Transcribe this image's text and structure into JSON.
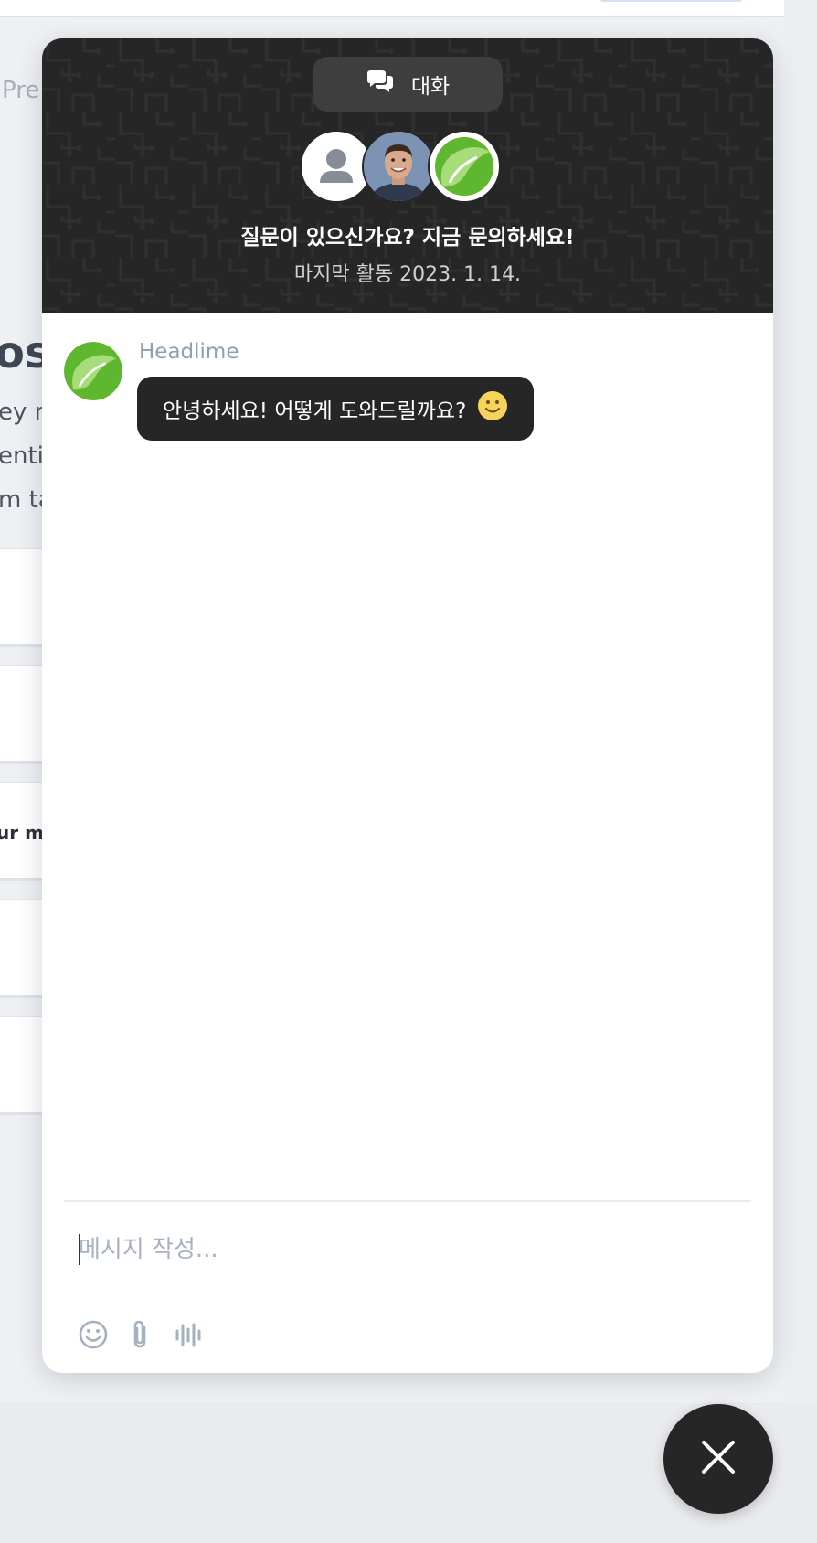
{
  "background": {
    "partial_pre": "Pre",
    "partial_heading": "osi",
    "partial_lines": [
      "ey n",
      "entic",
      "m ta"
    ],
    "partial_card_text": "ur ma"
  },
  "chat": {
    "tab_label": "대화",
    "headline": "질문이 있으신가요? 지금 문의하세요!",
    "last_active": "마지막 활동 2023. 1. 14.",
    "messages": [
      {
        "sender": "Headlime",
        "text": "안녕하세요! 어떻게 도와드릴까요?",
        "emoji": "🙂"
      }
    ],
    "composer": {
      "placeholder": "메시지 작성..."
    },
    "colors": {
      "header_bg": "#262626",
      "bubble_bg": "#262626",
      "accent_green": "#5fb62f"
    },
    "icons": [
      "chat-bubbles-icon",
      "emoji-icon",
      "attachment-icon",
      "voice-icon",
      "close-icon"
    ]
  }
}
